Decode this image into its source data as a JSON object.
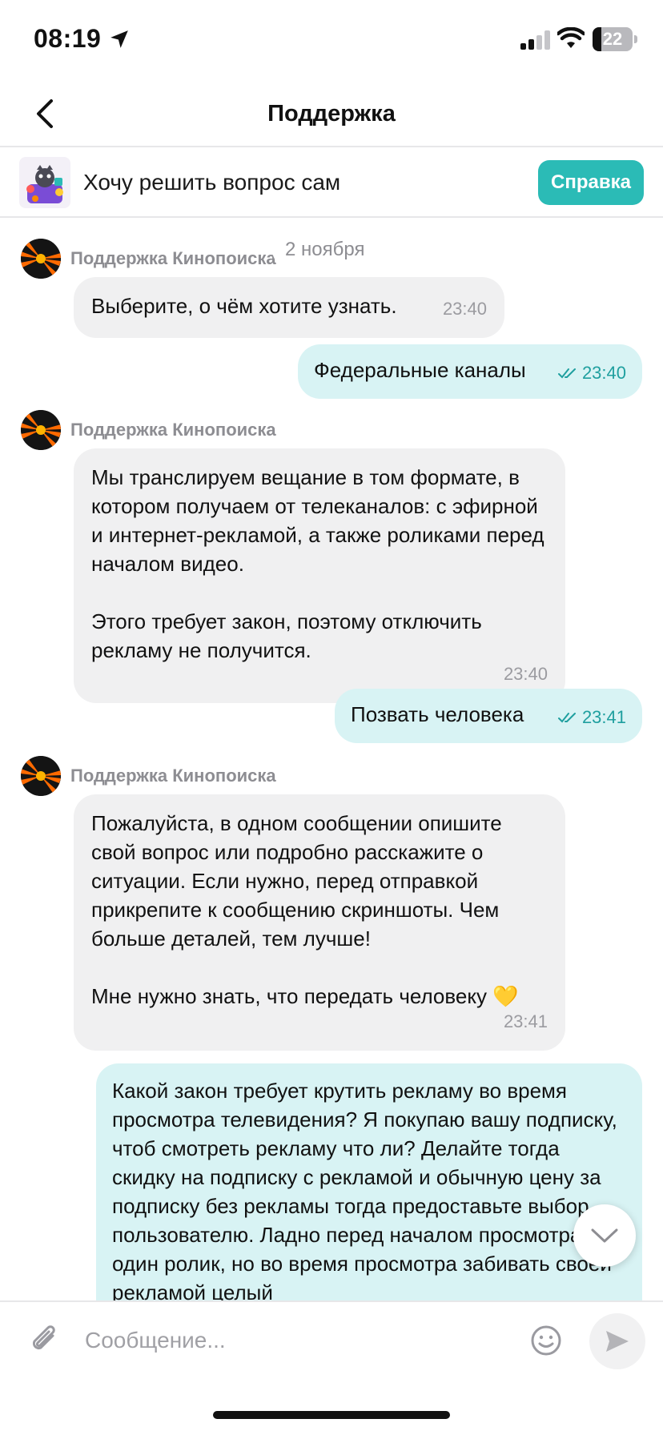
{
  "status_bar": {
    "time": "08:19",
    "battery": "22"
  },
  "header": {
    "title": "Поддержка"
  },
  "banner": {
    "text": "Хочу решить вопрос сам",
    "button": "Справка"
  },
  "date_separator": "2 ноября",
  "messages": [
    {
      "sender": "Поддержка Кинопоиска",
      "text": "Выберите, о чём хотите узнать.",
      "time": "23:40"
    },
    {
      "text": "Федеральные каналы",
      "time": "23:40"
    },
    {
      "sender": "Поддержка Кинопоиска",
      "paragraphs": [
        "Мы транслируем вещание в том формате, в котором получаем от телеканалов: с эфирной и интернет-рекламой, а также роликами перед началом видео.",
        "Этого требует закон, поэтому отключить рекламу не получится."
      ],
      "time": "23:40"
    },
    {
      "text": "Позвать человека",
      "time": "23:41"
    },
    {
      "sender": "Поддержка Кинопоиска",
      "paragraphs": [
        "Пожалуйста, в одном сообщении опишите свой вопрос или подробно расскажите о ситуации. Если нужно, перед отправкой прикрепите к сообщению скриншоты. Чем больше деталей, тем лучше!",
        "Мне нужно знать, что передать человеку 💛"
      ],
      "time": "23:41"
    },
    {
      "text": "Какой закон требует крутить рекламу во время просмотра телевидения? Я покупаю вашу подписку, чтоб смотреть рекламу что ли? Делайте тогда скидку на подписку с рекламой и обычную цену за подписку без рекламы тогда предоставьте выбор пользователю. Ладно перед началом просмотра один ролик, но во время просмотра забивать своей рекламой целый"
    }
  ],
  "composer": {
    "placeholder": "Сообщение..."
  },
  "colors": {
    "accent": "#2bbbb6",
    "outgoing_bubble": "#d8f3f4",
    "incoming_bubble": "#f0f0f1"
  },
  "icons": [
    "location-arrow-icon",
    "signal-icon",
    "wifi-icon",
    "battery-icon",
    "back-chevron-icon",
    "paperclip-icon",
    "emoji-icon",
    "send-icon",
    "chevron-down-icon"
  ]
}
